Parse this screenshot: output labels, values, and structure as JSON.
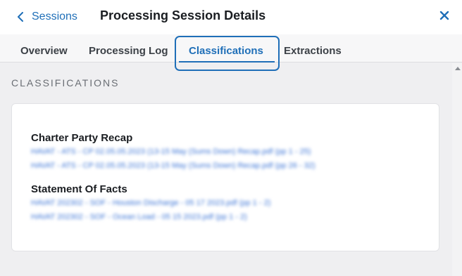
{
  "header": {
    "back_label": "Sessions",
    "title": "Processing Session Details"
  },
  "tabs": [
    {
      "label": "Overview",
      "active": false
    },
    {
      "label": "Processing Log",
      "active": false
    },
    {
      "label": "Classifications",
      "active": true
    },
    {
      "label": "Extractions",
      "active": false
    }
  ],
  "section": {
    "heading": "CLASSIFICATIONS"
  },
  "groups": [
    {
      "title": "Charter Party Recap",
      "files": [
        "HAVAT - ATS - CP 02.05.05.2023 (13-15 May (Sums Down) Recap.pdf (pp 1 - 25)",
        "HAVAT - ATS - CP 02.05.05.2023 (13-15 May (Sums Down) Recap.pdf (pp 26 - 32)"
      ]
    },
    {
      "title": "Statement Of Facts",
      "files": [
        "HAVAT 202302 - SOF - Houston Discharge - 05 17 2023.pdf (pp 1 - 2)",
        "HAVAT 202302 - SOF - Ocean Load - 05 15 2023.pdf (pp 1 - 2)"
      ]
    }
  ],
  "colors": {
    "accent": "#1f6fb8",
    "link": "#3b74d6",
    "background": "#efeff1"
  },
  "icons": {
    "back": "chevron-left-icon",
    "close": "close-icon"
  }
}
